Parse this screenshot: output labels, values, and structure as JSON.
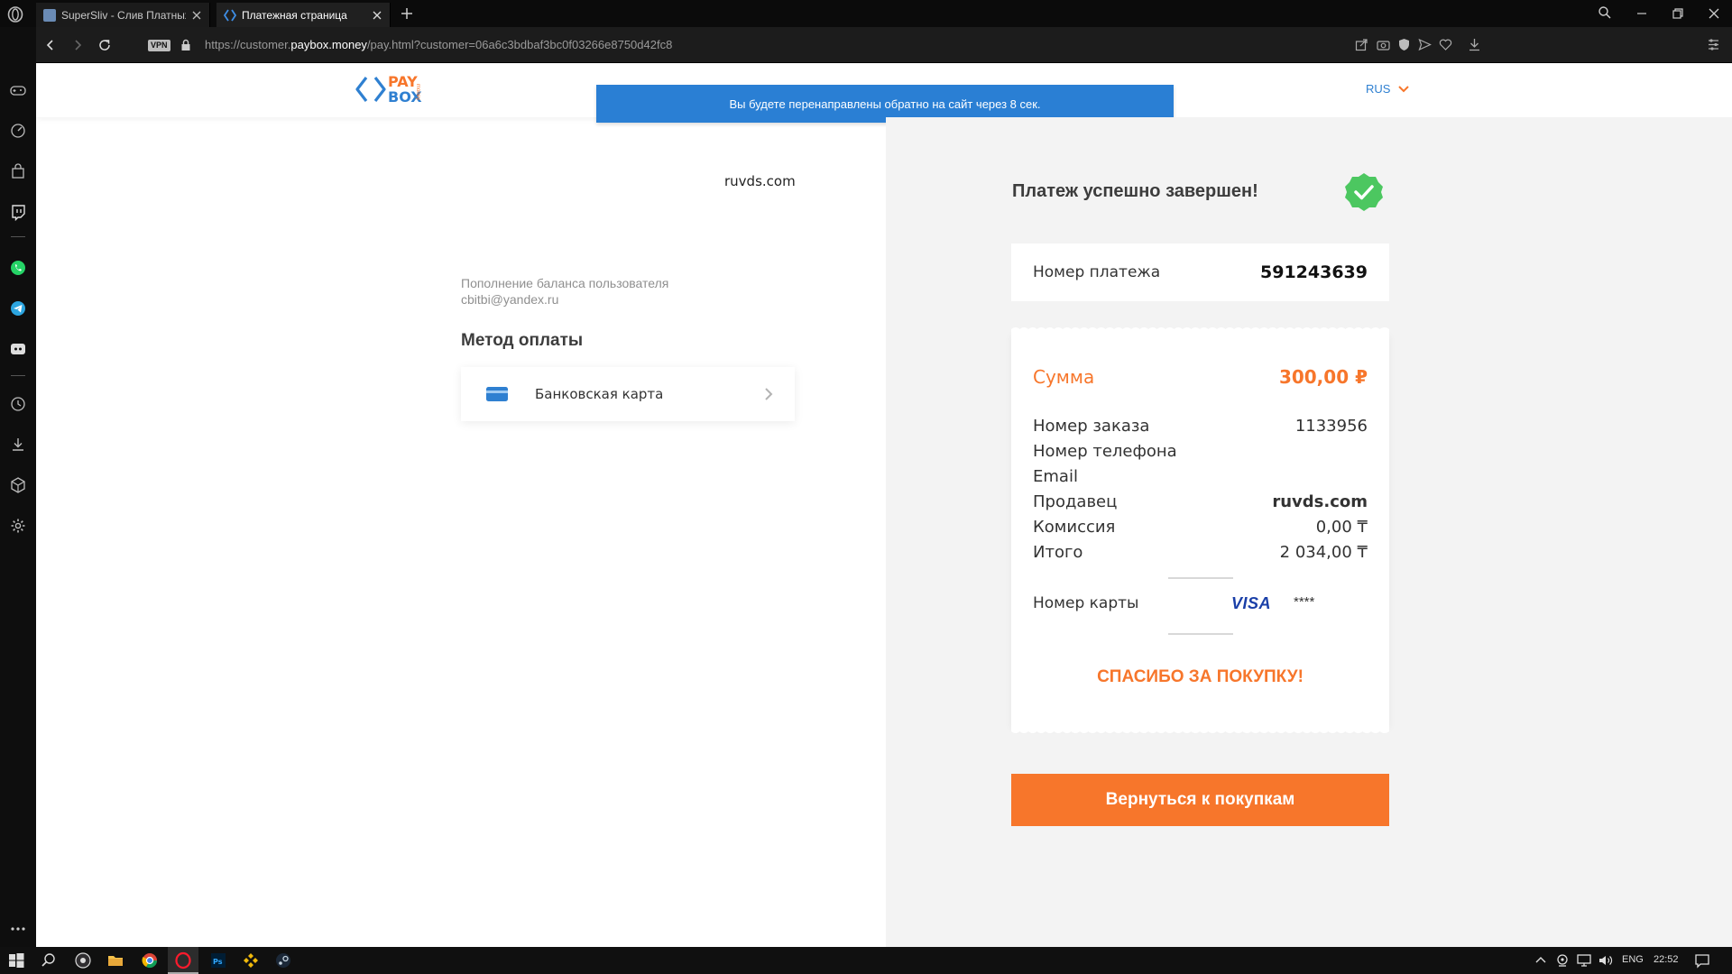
{
  "browser": {
    "tabs": [
      {
        "title": "SuperSliv - Слив Платных",
        "active": false
      },
      {
        "title": "Платежная страница",
        "active": true
      }
    ],
    "vpn_badge": "VPN",
    "url_prefix": "https://customer.",
    "url_domain": "paybox.money",
    "url_path": "/pay.html?customer=06a6c3bdbaf3bc0f03266e8750d42fc8"
  },
  "header": {
    "logo_pay": "PAY",
    "logo_box": "BOX",
    "logo_money": "money",
    "redirect_notice": "Вы будете перенаправлены обратно на сайт через 8 сек.",
    "language": "RUS"
  },
  "left": {
    "merchant": "ruvds.com",
    "description_line1": "Пополнение баланса пользователя",
    "description_line2": "cbitbi@yandex.ru",
    "method_heading": "Метод оплаты",
    "method_label": "Банковская карта"
  },
  "right": {
    "success_title": "Платеж успешно завершен!",
    "payment_number_label": "Номер платежа",
    "payment_number_value": "591243639",
    "amount_label": "Сумма",
    "amount_value": "300,00 ₽",
    "details": [
      {
        "label": "Номер заказа",
        "value": "1133956"
      },
      {
        "label": "Номер телефона",
        "value": ""
      },
      {
        "label": "Email",
        "value": ""
      },
      {
        "label": "Продавец",
        "value": "ruvds.com"
      },
      {
        "label": "Комиссия",
        "value": "0,00 ₸"
      },
      {
        "label": "Итого",
        "value": "2 034,00 ₸"
      }
    ],
    "card_label": "Номер карты",
    "card_brand": "VISA",
    "card_mask": "****",
    "thanks": "СПАСИБО ЗА ПОКУПКУ!",
    "return_button": "Вернуться к покупкам"
  },
  "taskbar": {
    "language": "ENG",
    "clock": "22:52"
  },
  "colors": {
    "accent_orange": "#f7762b",
    "brand_blue": "#2f80d1",
    "notice_blue": "#2a7fd4",
    "success_green": "#4cc760"
  }
}
